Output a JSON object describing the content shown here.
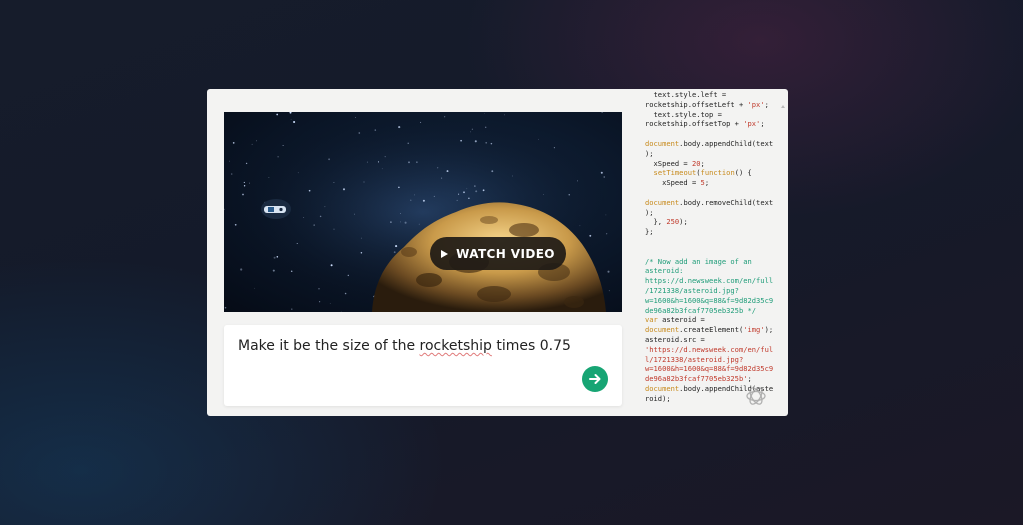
{
  "video": {
    "watch_label": "WATCH VIDEO"
  },
  "prompt": {
    "text_before": "Make it be the size of the ",
    "text_underlined": "rocketship",
    "text_after": " times 0.75"
  },
  "send_icon": "arrow-right-icon",
  "logo_icon": "openai-logo-icon",
  "colors": {
    "accent": "#17a574",
    "keyword": "#c78a1c",
    "string": "#c0392b",
    "comment": "#1e9c78"
  },
  "code": {
    "lines": [
      [
        {
          "t": "  text.style.left =",
          "c": ""
        }
      ],
      [
        {
          "t": "rocketship.offsetLeft + ",
          "c": ""
        },
        {
          "t": "'px'",
          "c": "str"
        },
        {
          "t": ";",
          "c": ""
        }
      ],
      [
        {
          "t": "  text.style.top =",
          "c": ""
        }
      ],
      [
        {
          "t": "rocketship.offsetTop + ",
          "c": ""
        },
        {
          "t": "'px'",
          "c": "str"
        },
        {
          "t": ";",
          "c": ""
        }
      ],
      [
        {
          "t": "",
          "c": ""
        }
      ],
      [
        {
          "t": "document",
          "c": "kw"
        },
        {
          "t": ".body.appendChild(text",
          "c": ""
        }
      ],
      [
        {
          "t": ");",
          "c": ""
        }
      ],
      [
        {
          "t": "  xSpeed = ",
          "c": ""
        },
        {
          "t": "20",
          "c": "num"
        },
        {
          "t": ";",
          "c": ""
        }
      ],
      [
        {
          "t": "  ",
          "c": ""
        },
        {
          "t": "setTimeout",
          "c": "kw"
        },
        {
          "t": "(",
          "c": ""
        },
        {
          "t": "function",
          "c": "kw"
        },
        {
          "t": "() {",
          "c": ""
        }
      ],
      [
        {
          "t": "    xSpeed = ",
          "c": ""
        },
        {
          "t": "5",
          "c": "num"
        },
        {
          "t": ";",
          "c": ""
        }
      ],
      [
        {
          "t": "",
          "c": ""
        }
      ],
      [
        {
          "t": "document",
          "c": "kw"
        },
        {
          "t": ".body.removeChild(text",
          "c": ""
        }
      ],
      [
        {
          "t": ");",
          "c": ""
        }
      ],
      [
        {
          "t": "  }, ",
          "c": ""
        },
        {
          "t": "250",
          "c": "num"
        },
        {
          "t": ");",
          "c": ""
        }
      ],
      [
        {
          "t": "};",
          "c": ""
        }
      ],
      [
        {
          "t": "",
          "c": ""
        }
      ],
      [
        {
          "t": "",
          "c": ""
        }
      ],
      [
        {
          "t": "/* Now add an image of an",
          "c": "cm"
        }
      ],
      [
        {
          "t": "asteroid:",
          "c": "cm"
        }
      ],
      [
        {
          "t": "https://d.newsweek.com/en/full",
          "c": "cm"
        }
      ],
      [
        {
          "t": "/1721338/asteroid.jpg?",
          "c": "cm"
        }
      ],
      [
        {
          "t": "w=1600&h=1600&q=88&f=9d82d35c9",
          "c": "cm"
        }
      ],
      [
        {
          "t": "de96a82b3fcaf7705eb325b */",
          "c": "cm"
        }
      ],
      [
        {
          "t": "var",
          "c": "kw"
        },
        {
          "t": " asteroid =",
          "c": ""
        }
      ],
      [
        {
          "t": "document",
          "c": "kw"
        },
        {
          "t": ".createElement(",
          "c": ""
        },
        {
          "t": "'img'",
          "c": "str"
        },
        {
          "t": ");",
          "c": ""
        }
      ],
      [
        {
          "t": "asteroid.src =",
          "c": ""
        }
      ],
      [
        {
          "t": "'https://d.newsweek.com/en/ful",
          "c": "str"
        }
      ],
      [
        {
          "t": "l/1721338/asteroid.jpg?",
          "c": "str"
        }
      ],
      [
        {
          "t": "w=1600&h=1600&q=88&f=9d82d35c9",
          "c": "str"
        }
      ],
      [
        {
          "t": "de96a82b3fcaf7705eb325b'",
          "c": "str"
        },
        {
          "t": ";",
          "c": ""
        }
      ],
      [
        {
          "t": "document",
          "c": "kw"
        },
        {
          "t": ".body.appendChild(aste",
          "c": ""
        }
      ],
      [
        {
          "t": "roid);",
          "c": ""
        }
      ]
    ]
  }
}
